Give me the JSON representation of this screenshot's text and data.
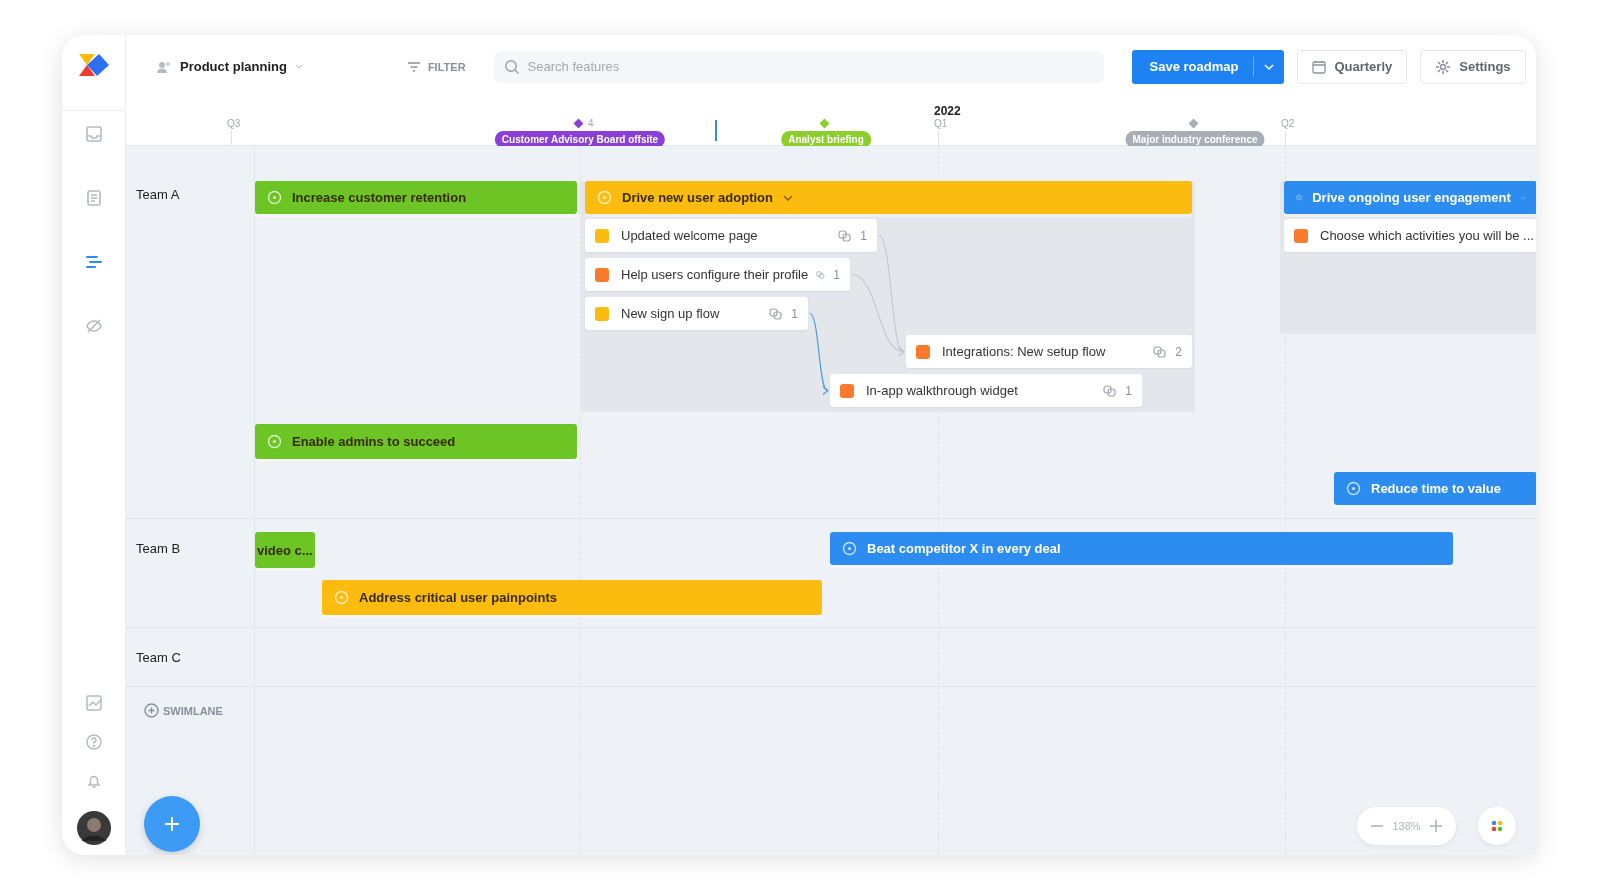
{
  "sidebar": {
    "items": [
      {
        "selected": false
      },
      {
        "selected": false
      },
      {
        "selected": true
      },
      {
        "selected": false
      }
    ],
    "bottom_items": [
      {
        "selected": false
      },
      {
        "selected": false
      },
      {
        "selected": false
      }
    ]
  },
  "toolbar": {
    "workspace": "Product planning",
    "filter": "FILTER",
    "search": {
      "placeholder": "Search features"
    },
    "save": "Save roadmap",
    "view": "Quarterly",
    "settings": "Settings"
  },
  "timeline": {
    "year": "2022",
    "quarters": [
      "Q3",
      "4",
      "Q1",
      "Q2"
    ],
    "milestones": [
      {
        "label": "Customer Advisory Board offsite",
        "color": "#8b3fd9"
      },
      {
        "label": "Analyst briefing",
        "color": "#8ccf2a"
      },
      {
        "label": "Major industry conference",
        "color": "#a9aeb5"
      }
    ]
  },
  "swimlanes": [
    {
      "name": "Team A",
      "items": [
        {
          "kind": "objective",
          "title": "Increase customer retention",
          "color": "#6cc425",
          "expanded": false
        },
        {
          "kind": "objective",
          "title": "Drive new user adoption",
          "color": "#fbbc0f",
          "expanded": true,
          "features": [
            {
              "title": "Updated welcome page",
              "color": "#fbbc0f",
              "links": "1"
            },
            {
              "title": "Help users configure their profile",
              "color": "#f97a2a",
              "links": "1"
            },
            {
              "title": "New sign up flow",
              "color": "#fbbc0f",
              "links": "1"
            },
            {
              "title": "Integrations: New setup flow",
              "color": "#f97a2a",
              "links": "2"
            },
            {
              "title": "In-app walkthrough widget",
              "color": "#f97a2a",
              "links": "1"
            }
          ],
          "connections": [
            {
              "selected": false
            },
            {
              "selected": false
            },
            {
              "selected": true
            }
          ]
        },
        {
          "kind": "objective",
          "title": "Enable admins to succeed",
          "color": "#6cc425",
          "expanded": false
        },
        {
          "kind": "objective",
          "title": "Drive ongoing user engagement",
          "color": "#2d8cf0",
          "expanded": true,
          "features": [
            {
              "title": "Choose which activities you will be ...",
              "color": "#f97a2a"
            }
          ]
        },
        {
          "kind": "objective",
          "title": "Reduce time to value",
          "color": "#2d8cf0",
          "expanded": false
        }
      ]
    },
    {
      "name": "Team B",
      "items": [
        {
          "kind": "objective",
          "title": "video c...",
          "color": "#6cc425",
          "expanded": false
        },
        {
          "kind": "objective",
          "title": "Beat competitor X in every deal",
          "color": "#2d8cf0",
          "expanded": false
        },
        {
          "kind": "objective",
          "title": "Address critical user painpoints",
          "color": "#fbbc0f",
          "expanded": false
        }
      ]
    },
    {
      "name": "Team C"
    }
  ],
  "add_swimlane": "SWIMLANE",
  "zoom": {
    "value": "138%"
  }
}
